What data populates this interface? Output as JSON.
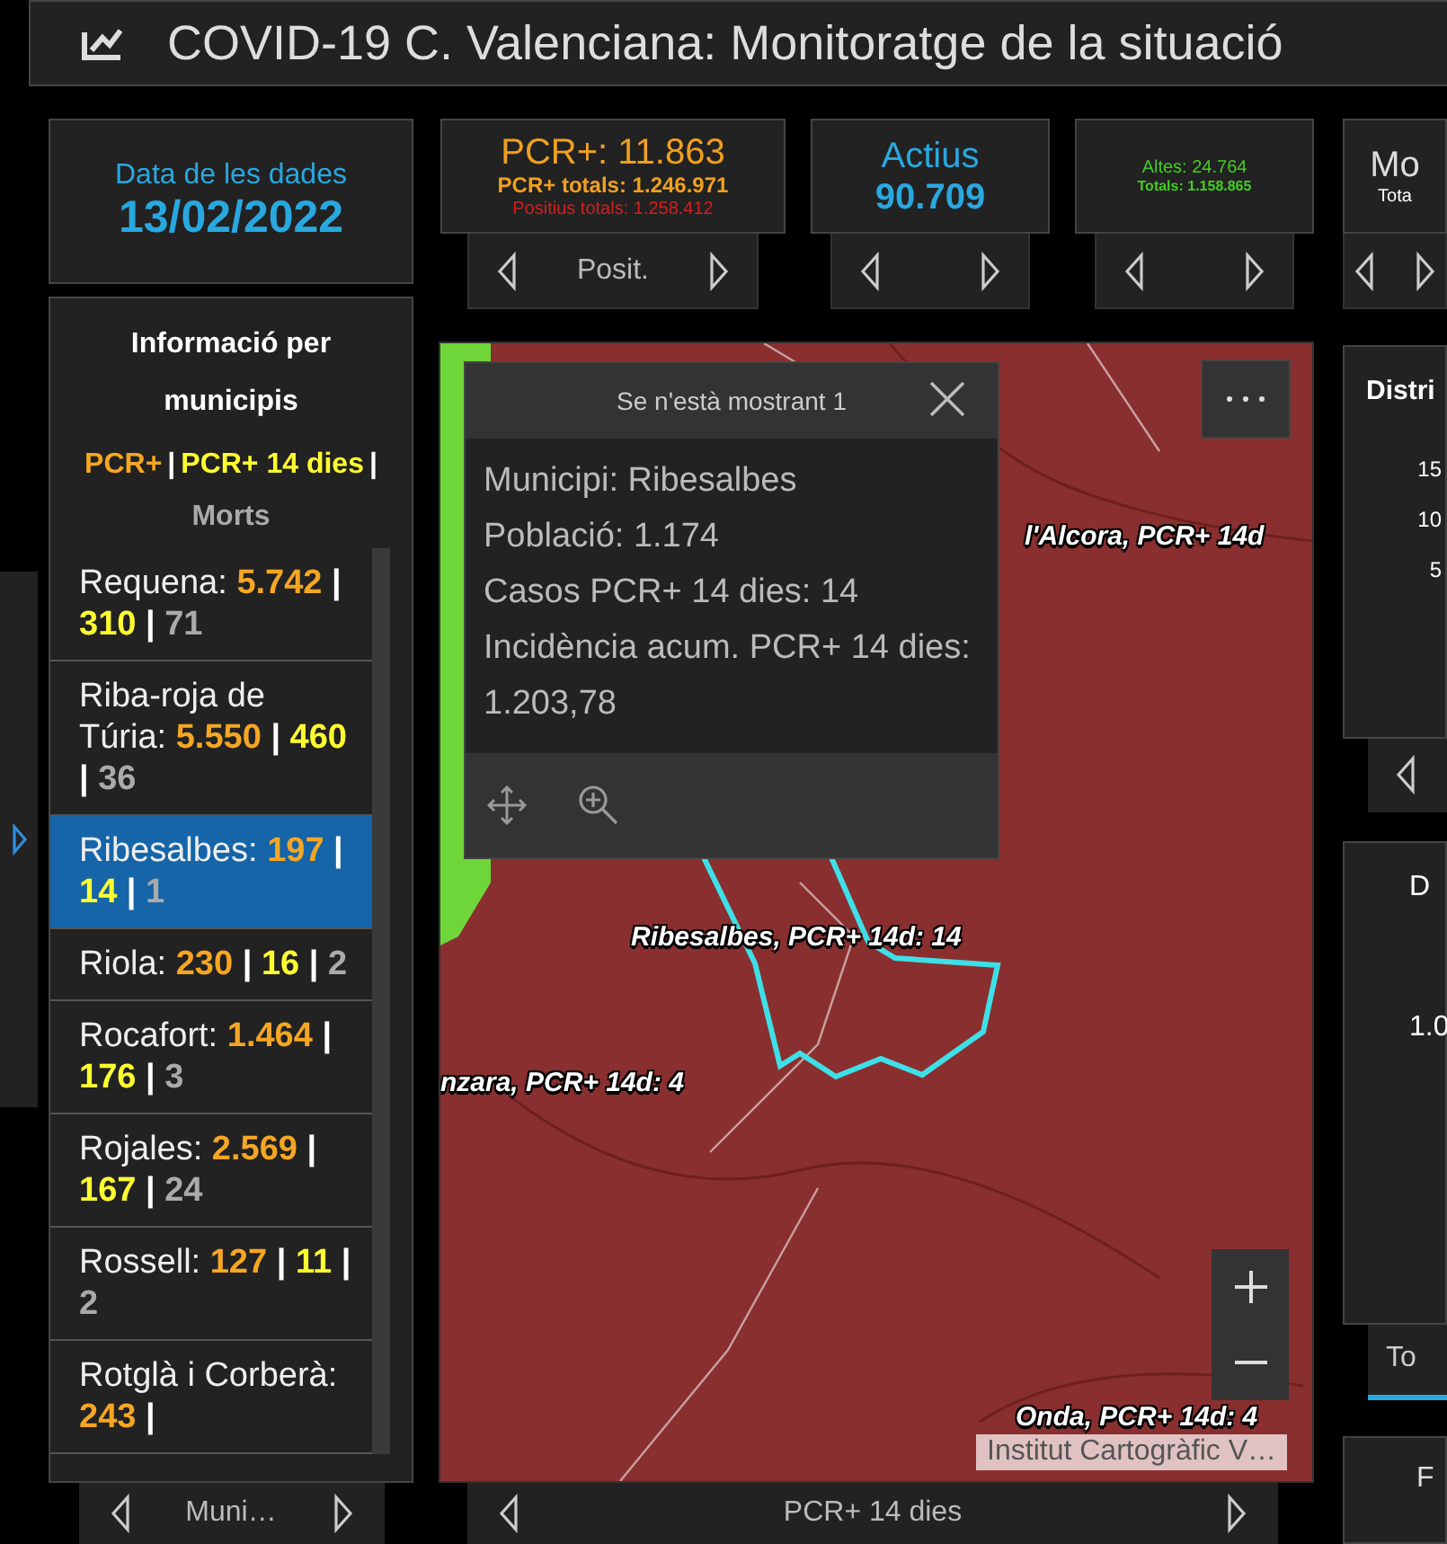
{
  "header": {
    "title": "COVID-19 C. Valenciana: Monitoratge de la situació"
  },
  "indicators": [
    {
      "kind": "date",
      "lines": [
        {
          "text": "Data de les dades",
          "color": "#29a8e0",
          "kind": "label"
        },
        {
          "text": "13/02/2022",
          "color": "#29a8e0",
          "kind": "value"
        }
      ]
    },
    {
      "kind": "nav",
      "label": "Posit.",
      "lines": [
        {
          "text": "PCR+: 11.863",
          "color": "#f0a020",
          "kind": "title"
        },
        {
          "text": "PCR+ totals: 1.246.971",
          "color": "#f0a020",
          "kind": "sub"
        },
        {
          "text": "Positius totals: 1.258.412",
          "color": "#d02020",
          "kind": "note"
        }
      ]
    },
    {
      "kind": "nav",
      "lines": [
        {
          "text": "Actius",
          "color": "#29a8e0",
          "kind": "title"
        },
        {
          "text": "90.709",
          "color": "#29a8e0",
          "kind": "number"
        }
      ]
    },
    {
      "kind": "nav",
      "lines": [
        {
          "text": "Altes: 24.764",
          "color": "#44cc22",
          "kind": "note"
        },
        {
          "text": "Totals: 1.158.865",
          "color": "#44cc22",
          "kind": "tiny"
        }
      ]
    },
    {
      "kind": "nav",
      "lines": [
        {
          "text": "Mo",
          "color": "#dddddd",
          "kind": "title"
        },
        {
          "text": "Tota",
          "color": "#ffffff",
          "kind": "note"
        }
      ]
    }
  ],
  "municipalities": {
    "title": "Informació per municipis",
    "legend": [
      {
        "kind": "pcr",
        "text": "PCR+"
      },
      {
        "kind": "sep",
        "text": "|"
      },
      {
        "kind": "pcr14",
        "text": "PCR+ 14 dies"
      },
      {
        "kind": "sep",
        "text": "|"
      },
      {
        "kind": "deaths",
        "text": "Morts"
      }
    ],
    "items": [
      {
        "name": "Requena:",
        "values": [
          {
            "kind": "pcr",
            "text": "5.742"
          },
          {
            "kind": "sep",
            "text": "|"
          },
          {
            "kind": "pcr14",
            "text": "310"
          },
          {
            "kind": "sep",
            "text": "|"
          },
          {
            "kind": "deaths",
            "text": "71"
          }
        ],
        "selected": false
      },
      {
        "name": "Riba-roja de Túria:",
        "values": [
          {
            "kind": "pcr",
            "text": "5.550"
          },
          {
            "kind": "sep",
            "text": "|"
          },
          {
            "kind": "pcr14",
            "text": "460"
          },
          {
            "kind": "sep",
            "text": "|"
          },
          {
            "kind": "deaths",
            "text": "36"
          }
        ],
        "selected": false
      },
      {
        "name": "Ribesalbes:",
        "values": [
          {
            "kind": "pcr",
            "text": "197"
          },
          {
            "kind": "sep",
            "text": "|"
          },
          {
            "kind": "pcr14",
            "text": "14"
          },
          {
            "kind": "sep",
            "text": "|"
          },
          {
            "kind": "deaths",
            "text": "1"
          }
        ],
        "selected": true
      },
      {
        "name": "Riola:",
        "values": [
          {
            "kind": "pcr",
            "text": "230"
          },
          {
            "kind": "sep",
            "text": "|"
          },
          {
            "kind": "pcr14",
            "text": "16"
          },
          {
            "kind": "sep",
            "text": "|"
          },
          {
            "kind": "deaths",
            "text": "2"
          }
        ],
        "selected": false
      },
      {
        "name": "Rocafort:",
        "values": [
          {
            "kind": "pcr",
            "text": "1.464"
          },
          {
            "kind": "sep",
            "text": "|"
          },
          {
            "kind": "pcr14",
            "text": "176"
          },
          {
            "kind": "sep",
            "text": "|"
          },
          {
            "kind": "deaths",
            "text": "3"
          }
        ],
        "selected": false
      },
      {
        "name": "Rojales:",
        "values": [
          {
            "kind": "pcr",
            "text": "2.569"
          },
          {
            "kind": "sep",
            "text": "|"
          },
          {
            "kind": "pcr14",
            "text": "167"
          },
          {
            "kind": "sep",
            "text": "|"
          },
          {
            "kind": "deaths",
            "text": "24"
          }
        ],
        "selected": false
      },
      {
        "name": "Rossell:",
        "values": [
          {
            "kind": "pcr",
            "text": "127"
          },
          {
            "kind": "sep",
            "text": "|"
          },
          {
            "kind": "pcr14",
            "text": "11"
          },
          {
            "kind": "sep",
            "text": "|"
          },
          {
            "kind": "deaths",
            "text": "2"
          }
        ],
        "selected": false
      },
      {
        "name": "Rotglà i Corberà:",
        "values": [
          {
            "kind": "pcr",
            "text": "243"
          },
          {
            "kind": "sep",
            "text": "|"
          }
        ],
        "selected": false
      }
    ],
    "nav_label": "Muni…"
  },
  "map": {
    "popup": {
      "title": "Se n'està mostrant 1",
      "lines": [
        "Municipi: Ribesalbes",
        "Població: 1.174",
        "Casos PCR+ 14 dies: 14",
        "Incidència acum. PCR+ 14 dies: 1.203,78"
      ]
    },
    "labels": [
      "l'Alcora, PCR+ 14d",
      "Ribesalbes, PCR+ 14d: 14",
      "nzara, PCR+ 14d: 4",
      "Onda, PCR+ 14d: 4"
    ],
    "attribution": "Institut Cartogràfic V…",
    "nav_label": "PCR+ 14 dies"
  },
  "right_panels": {
    "chart_title": "Distri",
    "ticks": [
      "15",
      "10",
      "5"
    ],
    "panel2_title": "D",
    "panel2_value": "1.0",
    "tab": "To",
    "panel3_title": "F"
  }
}
